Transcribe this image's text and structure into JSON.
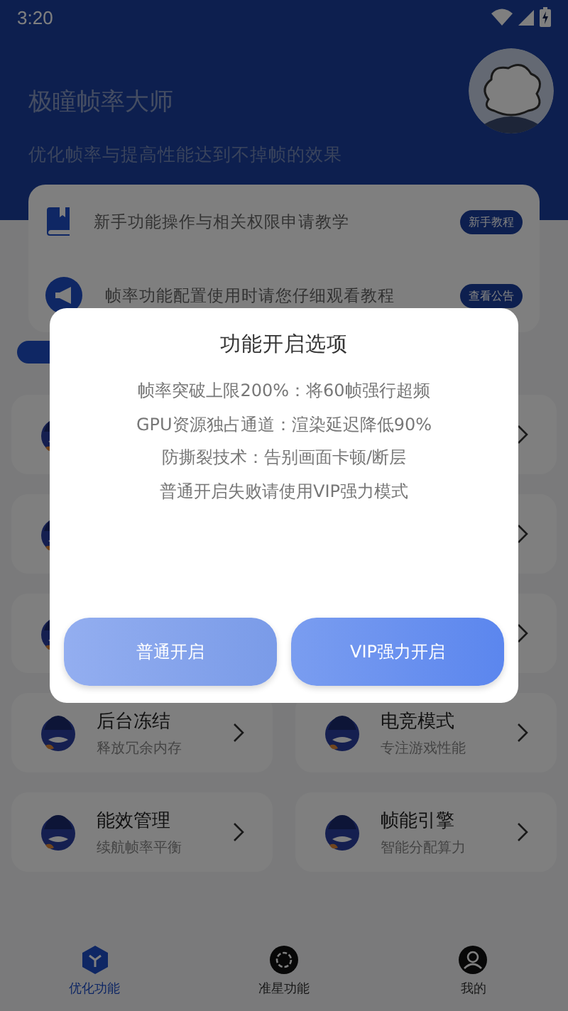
{
  "status_bar": {
    "time": "3:20"
  },
  "header": {
    "title": "极瞳帧率大师",
    "subtitle": "优化帧率与提高性能达到不掉帧的效果"
  },
  "notices": [
    {
      "kind": "book",
      "text": "新手功能操作与相关权限申请教学",
      "badge": "新手教程"
    },
    {
      "kind": "megaphone",
      "text": "帧率功能配置使用时请您仔细观看教程",
      "badge": "查看公告"
    }
  ],
  "feature_cards": [
    {
      "kind": "covered"
    },
    {
      "kind": "covered"
    },
    {
      "kind": "covered"
    },
    {
      "kind": "covered"
    },
    {
      "kind": "covered"
    },
    {
      "kind": "covered"
    },
    {
      "kind": "feature",
      "title": "后台冻结",
      "subtitle": "释放冗余内存"
    },
    {
      "kind": "feature",
      "title": "电竞模式",
      "subtitle": "专注游戏性能"
    },
    {
      "kind": "feature",
      "title": "能效管理",
      "subtitle": "续航帧率平衡"
    },
    {
      "kind": "feature",
      "title": "帧能引擎",
      "subtitle": "智能分配算力"
    }
  ],
  "bottom_nav": [
    {
      "kind": "cube",
      "label": "优化功能",
      "selected": true
    },
    {
      "kind": "gear",
      "label": "准星功能",
      "selected": false
    },
    {
      "kind": "person",
      "label": "我的",
      "selected": false
    }
  ],
  "dialog": {
    "title": "功能开启选项",
    "lines": [
      "帧率突破上限200%：将60帧强行超频",
      "GPU资源独占通道：渲染延迟降低90%",
      "防撕裂技术：告别画面卡顿/断层",
      "普通开启失败请使用VIP强力模式"
    ],
    "buttons": [
      {
        "label": "普通开启"
      },
      {
        "label": "VIP强力开启"
      }
    ]
  }
}
